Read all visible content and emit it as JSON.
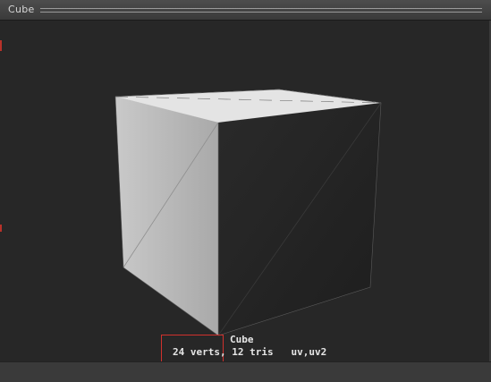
{
  "panel": {
    "title": "Cube"
  },
  "preview": {
    "object_name": "Cube",
    "stats": "24 verts, 12 tris   uv,uv2"
  },
  "colors": {
    "background": "#272727",
    "cube_top": "#e4e4e4",
    "cube_left": "#b9b9b9",
    "cube_right": "#222222",
    "highlight": "#d0312d"
  }
}
